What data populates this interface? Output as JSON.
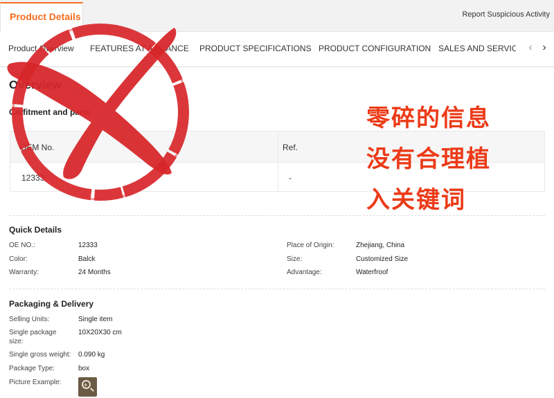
{
  "header": {
    "active_tab": "Product Details",
    "report_link": "Report Suspicious Activity"
  },
  "nav": {
    "items": [
      "Product Overview",
      "FEATURES AT A GLANCE",
      "PRODUCT SPECIFICATIONS",
      "PRODUCT CONFIGURATION",
      "SALES AND SERVICE"
    ],
    "prev_icon": "chevron-left-icon",
    "next_icon": "chevron-right-icon"
  },
  "overview": {
    "title": "Overview",
    "fitment_title": "Carfitment and parts",
    "table": {
      "headers": [
        "OEM No.",
        "Ref."
      ],
      "row": [
        "12333",
        "-"
      ]
    }
  },
  "quick_details": {
    "title": "Quick Details",
    "left": [
      {
        "label": "OE NO.:",
        "value": "12333"
      },
      {
        "label": "Color:",
        "value": "Balck"
      },
      {
        "label": "Warranty:",
        "value": "24 Months"
      }
    ],
    "right": [
      {
        "label": "Place of Origin:",
        "value": "Zhejiang, China"
      },
      {
        "label": "Size:",
        "value": "Customized Size"
      },
      {
        "label": "Advantage:",
        "value": "Waterfroof"
      }
    ]
  },
  "packaging": {
    "title": "Packaging & Delivery",
    "rows": [
      {
        "label": "Selling Units:",
        "value": "Single item"
      },
      {
        "label": "Single package size:",
        "value": "10X20X30 cm"
      },
      {
        "label": "Single gross weight:",
        "value": "0.090 kg"
      },
      {
        "label": "Package Type:",
        "value": "box"
      },
      {
        "label": "Picture Example:",
        "value": ""
      }
    ]
  },
  "annotation": {
    "lines": [
      "零碎的信息",
      "没有合理植",
      "入关键词"
    ]
  },
  "colors": {
    "accent": "#f56d1f",
    "stamp_red": "#d8272b",
    "annotation_red": "#ec3a17"
  }
}
